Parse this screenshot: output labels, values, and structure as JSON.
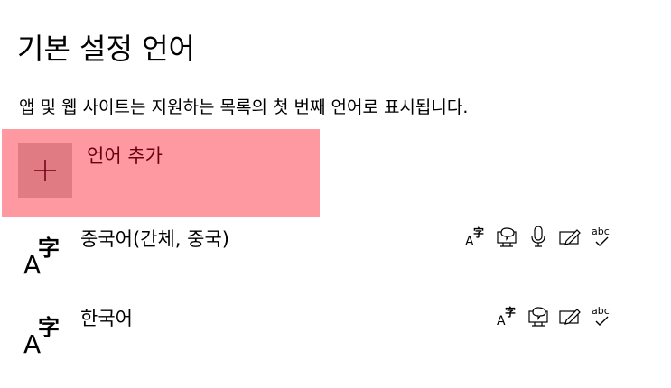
{
  "page": {
    "title": "기본 설정 언어",
    "description": "앱 및 웹 사이트는 지원하는 목록의 첫 번째 언어로 표시됩니다."
  },
  "add_language": {
    "label": "언어 추가",
    "icon": "plus-icon"
  },
  "languages": [
    {
      "name": "중국어(간체, 중국)",
      "icon": "language-icon",
      "features": [
        "language-pack-icon",
        "text-to-speech-icon",
        "speech-recognition-icon",
        "handwriting-icon",
        "spell-check-icon"
      ]
    },
    {
      "name": "한국어",
      "icon": "language-icon",
      "features": [
        "language-pack-icon",
        "text-to-speech-icon",
        "handwriting-icon",
        "spell-check-icon"
      ]
    }
  ],
  "feature_glyphs": {
    "spell_check_text": "abc",
    "language_glyph_latin": "A",
    "language_glyph_cjk": "字"
  },
  "colors": {
    "accent_highlight": "#ff99a1",
    "accent_tile": "#e07a83",
    "add_label_text": "#6b0010"
  }
}
